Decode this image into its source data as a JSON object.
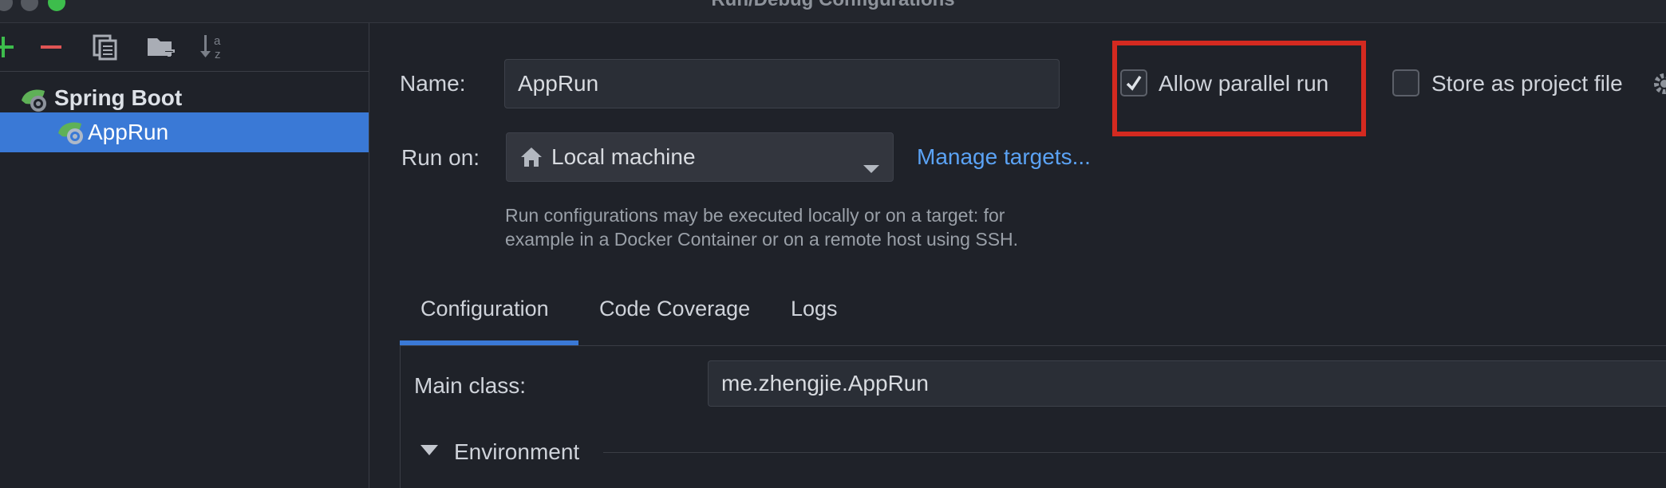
{
  "window": {
    "title": "Run/Debug Configurations",
    "traffic_lights": [
      "#555960",
      "#555960",
      "#3dbd4c"
    ]
  },
  "sidebar": {
    "toolbar_icons": [
      "add-icon",
      "remove-icon",
      "copy-icon",
      "new-folder-icon",
      "sort-alphabetically-icon"
    ],
    "tree": [
      {
        "label": "Spring Boot",
        "icon": "spring-boot-icon",
        "selected": false
      },
      {
        "label": "AppRun",
        "icon": "spring-boot-icon",
        "selected": true
      }
    ]
  },
  "form": {
    "name_label": "Name:",
    "name_value": "AppRun",
    "allow_parallel": {
      "label": "Allow parallel run",
      "checked": true
    },
    "store_project_file": {
      "label": "Store as project file",
      "checked": false
    },
    "run_on_label": "Run on:",
    "run_on_value": "Local machine",
    "manage_targets": "Manage targets...",
    "help_line1": "Run configurations may be executed locally or on a target: for",
    "help_line2": "example in a Docker Container or on a remote host using SSH."
  },
  "tabs": [
    {
      "label": "Configuration",
      "active": true
    },
    {
      "label": "Code Coverage",
      "active": false
    },
    {
      "label": "Logs",
      "active": false
    }
  ],
  "config": {
    "main_class_label": "Main class:",
    "main_class_value": "me.zhengjie.AppRun",
    "environment_label": "Environment"
  },
  "colors": {
    "accent": "#3a79d6",
    "link": "#5ba3f5",
    "highlight": "#d42a20",
    "add": "#3dbd4c",
    "remove": "#e05555"
  }
}
